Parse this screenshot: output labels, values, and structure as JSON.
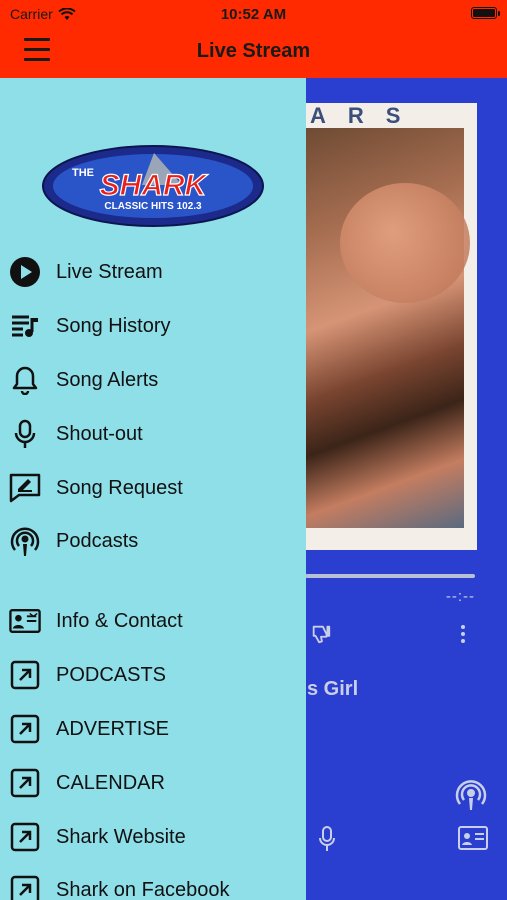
{
  "status_bar": {
    "carrier": "Carrier",
    "time": "10:52 AM"
  },
  "header": {
    "title": "Live Stream"
  },
  "logo": {
    "top_text": "THE",
    "main_text": "SHARK",
    "sub_text": "CLASSIC HITS 102.3"
  },
  "menu": [
    {
      "label": "Live Stream",
      "icon": "play-circle-icon"
    },
    {
      "label": "Song History",
      "icon": "playlist-icon"
    },
    {
      "label": "Song Alerts",
      "icon": "bell-icon"
    },
    {
      "label": "Shout-out",
      "icon": "microphone-icon"
    },
    {
      "label": "Song Request",
      "icon": "request-edit-icon"
    },
    {
      "label": "Podcasts",
      "icon": "podcast-icon"
    },
    {
      "label": "Info & Contact",
      "icon": "contact-card-icon"
    },
    {
      "label": "PODCASTS",
      "icon": "external-link-icon"
    },
    {
      "label": "ADVERTISE",
      "icon": "external-link-icon"
    },
    {
      "label": "CALENDAR",
      "icon": "external-link-icon"
    },
    {
      "label": "Shark Website",
      "icon": "external-link-icon"
    },
    {
      "label": "Shark on Facebook",
      "icon": "external-link-icon"
    }
  ],
  "player": {
    "album_letters": "ARS",
    "time_display": "--:--",
    "track_title_visible": "s Girl"
  },
  "colors": {
    "header_bg": "#ff2a00",
    "drawer_bg": "#8fdfe9",
    "player_bg": "#2a3fcf"
  }
}
